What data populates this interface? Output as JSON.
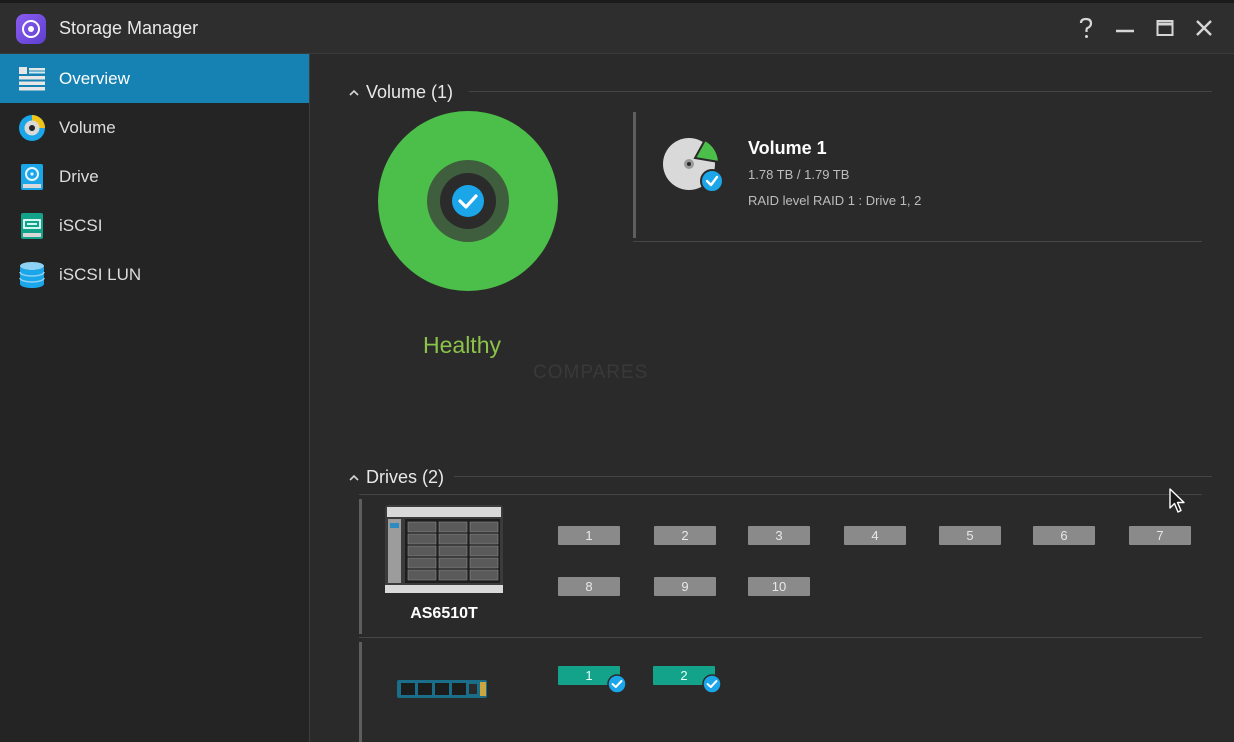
{
  "window": {
    "title": "Storage Manager",
    "help_icon": "help-icon",
    "minimize_icon": "minimize-icon",
    "maximize_icon": "maximize-icon",
    "close_icon": "close-icon"
  },
  "sidebar": {
    "items": [
      {
        "label": "Overview",
        "icon": "overview-icon",
        "active": true
      },
      {
        "label": "Volume",
        "icon": "volume-icon",
        "active": false
      },
      {
        "label": "Drive",
        "icon": "drive-icon",
        "active": false
      },
      {
        "label": "iSCSI",
        "icon": "iscsi-icon",
        "active": false
      },
      {
        "label": "iSCSI LUN",
        "icon": "iscsi-lun-icon",
        "active": false
      }
    ]
  },
  "volume_section": {
    "title": "Volume (1)",
    "status": "Healthy",
    "watermark": "COMPARES",
    "volume": {
      "name": "Volume 1",
      "capacity": "1.78 TB / 1.79 TB",
      "raid": "RAID level RAID 1 : Drive 1, 2"
    }
  },
  "drives_section": {
    "title": "Drives (2)",
    "nas": {
      "model": "AS6510T",
      "bays": [
        "1",
        "2",
        "3",
        "4",
        "5",
        "6",
        "7",
        "8",
        "9",
        "10"
      ]
    },
    "nvme": {
      "slots": [
        "1",
        "2"
      ]
    }
  },
  "colors": {
    "accent": "#1582b3",
    "healthy": "#8bc34a",
    "ring": "#4cbe4a",
    "ok_slot": "#12a38a",
    "empty_slot": "#8a8a8a",
    "check": "#1aa6e8"
  }
}
